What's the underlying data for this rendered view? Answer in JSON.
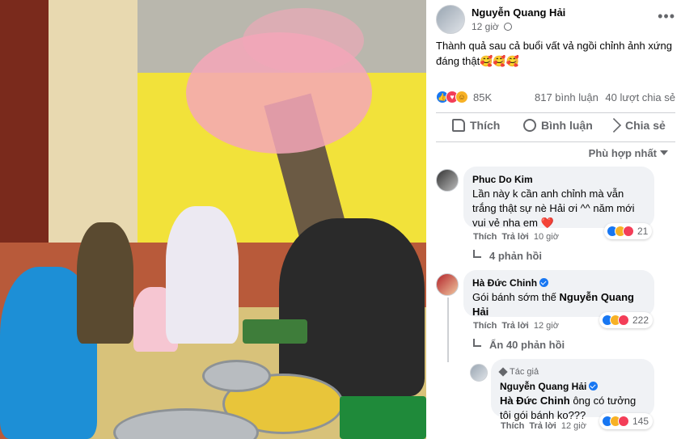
{
  "post": {
    "author": "Nguyễn Quang Hải",
    "time": "12 giờ",
    "caption": "Thành quả sau cả buổi vất vả ngồi chỉnh ảnh xứng đáng thật🥰🥰🥰",
    "reactions_count": "85K",
    "comments_count": "817 bình luận",
    "shares_count": "40 lượt chia sẻ"
  },
  "actions": {
    "like": "Thích",
    "comment": "Bình luận",
    "share": "Chia sẻ"
  },
  "sort_label": "Phù hợp nhất",
  "comments": [
    {
      "name": "Phuc Do Kim",
      "text": "Lần này k cần anh chỉnh mà vẫn trắng thật sự nè Hải ơi ^^ năm mới vui vẻ nha em ❤️",
      "like": "Thích",
      "reply": "Trả lời",
      "time": "10 giờ",
      "reactions": "21",
      "replies_link": "4 phản hồi"
    },
    {
      "name": "Hà Đức Chinh",
      "text_prefix": "Gói bánh sớm thế ",
      "mention": "Nguyễn Quang Hải",
      "like": "Thích",
      "reply": "Trả lời",
      "time": "12 giờ",
      "reactions": "222",
      "replies_link": "Ẩn 40 phản hồi"
    }
  ],
  "reply": {
    "author_tag": "Tác giả",
    "name": "Nguyễn Quang Hải",
    "mention": "Hà Đức Chinh",
    "text_suffix": " ông có tưởng tôi gói bánh ko???",
    "like": "Thích",
    "reply": "Trả lời",
    "time": "12 giờ",
    "reactions": "145"
  },
  "colors": {
    "like_blue": "#1877f2",
    "love_red": "#f33e58",
    "haha_yellow": "#f7b125",
    "bubble_bg": "#f0f2f5",
    "muted_text": "#65676b"
  },
  "icons": [
    "more-icon",
    "globe-icon",
    "like-icon",
    "comment-icon",
    "share-icon",
    "chevron-down-icon",
    "verified-icon",
    "reply-arrow-icon",
    "pen-icon"
  ]
}
